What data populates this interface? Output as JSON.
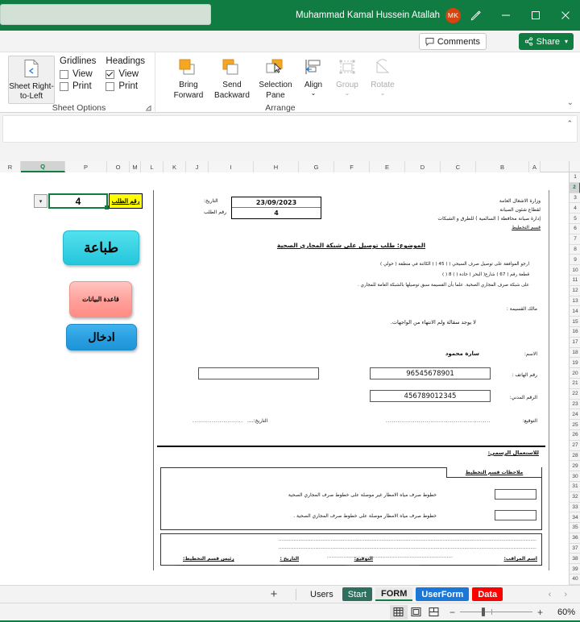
{
  "titlebar": {
    "search_placeholder": "",
    "account_name": "Muhammad Kamal Hussein Atallah",
    "avatar_initials": "MK",
    "pen_icon": "pen-icon",
    "minimize_label": "–",
    "restore_label": "❐",
    "close_label": "✕"
  },
  "command": {
    "comments_label": "Comments",
    "share_label": "Share",
    "share_caret": "▾"
  },
  "ribbon": {
    "sheet_options": {
      "group_label": "Sheet Options",
      "sheet_rtl_line1": "Sheet Right-",
      "sheet_rtl_line2": "to-Left",
      "gridlines_header": "Gridlines",
      "gridlines_view": "View",
      "gridlines_print": "Print",
      "gridlines_view_checked": false,
      "gridlines_print_checked": false,
      "headings_header": "Headings",
      "headings_view": "View",
      "headings_print": "Print",
      "headings_view_checked": true,
      "headings_print_checked": false,
      "dialog_launcher": "⌐"
    },
    "arrange": {
      "group_label": "Arrange",
      "bring_forward_l1": "Bring",
      "bring_forward_l2": "Forward",
      "send_backward_l1": "Send",
      "send_backward_l2": "Backward",
      "selection_pane_l1": "Selection",
      "selection_pane_l2": "Pane",
      "align_label": "Align",
      "group_btn_label": "Group",
      "rotate_label": "Rotate",
      "dropdown_caret": "⌄"
    },
    "collapse_caret": "⌄"
  },
  "formula_bar": {
    "value": "",
    "expand_caret": "⌃"
  },
  "grid": {
    "columns": [
      "R",
      "Q",
      "P",
      "O",
      "M",
      "L",
      "K",
      "J",
      "I",
      "H",
      "G",
      "F",
      "E",
      "D",
      "C",
      "B",
      "A"
    ],
    "selected_column": "Q",
    "rows": [
      1,
      2,
      3,
      4,
      5,
      6,
      7,
      8,
      9,
      10,
      11,
      12,
      13,
      14,
      15,
      16,
      17,
      18,
      19,
      20,
      21,
      22,
      23,
      24,
      25,
      26,
      27,
      28,
      29,
      30,
      31,
      32,
      33,
      34,
      35,
      36,
      37,
      38,
      39,
      40
    ],
    "selected_row": 2
  },
  "namebox": {
    "cell_value": "4",
    "dropdown_caret": "▾",
    "order_label": "رقم الطلب"
  },
  "macro_buttons": [
    {
      "name": "print-button",
      "label": "طباعة",
      "color": "#24c6dc"
    },
    {
      "name": "database-button",
      "label": "قاعدة البيانات",
      "color": "#ff8d86"
    },
    {
      "name": "entry-button",
      "label": "ادخال",
      "color": "#1e93d6"
    }
  ],
  "form": {
    "ministry": [
      "وزارة الاشغال العامة",
      "لقطاع شئون الصيانة",
      "إدارة صيانة محافظة (    السالمية    ) للطرق و الشبكات",
      "قسم التخطيط"
    ],
    "date_label": "التاريخ:",
    "date_value": "23/09/2023",
    "order_no_label": "رقم الطلب",
    "order_no_value": "4",
    "subject": "الموضوع: طلب توصيل على شبكة المجاري الصحية",
    "request_line1": "ارجو الموافقة على توصيل صرف السيحي (            )        45        (          )   الكائنة في منطقة (      حولي        )",
    "request_line2": "قطعة رقم (     67      )  شارع(         البحر         )                جادة           (          )       8       (          )",
    "request_line3": "على شبكة صرف المجاري الصحية.          علما بأن القسيمة      سبق         توصيلها بالشبكة العامة للمجاري .",
    "owner_label": "مالك القسيمة :",
    "owner_note": "لا يوجد سقالة ولم الانتهاء من الواجهات.",
    "name_label": "الاسم:",
    "name_value": "سارة محمود",
    "phone_label": "رقم الهاتف :",
    "phone_value": "96545678901",
    "civilid_label": "الرقم المدني:",
    "civilid_value": "456789012345",
    "signature_label": "التوقيع:",
    "date2_label": "التاريخ:....",
    "dots": "......................................................",
    "dots_short": "..........................",
    "official_use": "للاستعمال الرسمي:",
    "planning_notes_tab": "ملاحظات قسم التخطيط",
    "note_row1": "خطوط صرف مياه الامطار غير موصلة على خطوط صرف المجاري الصحية",
    "note_row2": "خطوط صرف مياه الامطار موصلة على خطوط صرف المجاري الصحية .",
    "dots_long": "........................................................................................................................................................................",
    "dots_mid": "..................................................................................",
    "sig_inspector": "اسم المراقب:",
    "sig_signature": "التوقيع:",
    "sig_date": "التاريخ :",
    "sig_head": "رئيس قسم التخطيط:"
  },
  "sheet_tabs": {
    "add_label": "+",
    "tabs": [
      {
        "label": "Users",
        "style": "plain",
        "active": false
      },
      {
        "label": "Start",
        "style": "green",
        "active": false
      },
      {
        "label": "FORM",
        "style": "active",
        "active": true
      },
      {
        "label": "UserForm",
        "style": "blue",
        "active": false
      },
      {
        "label": "Data",
        "style": "red",
        "active": false
      }
    ],
    "prev_arrow": "‹",
    "next_arrow": "›"
  },
  "statusbar": {
    "normal_view": "normal-view-icon",
    "page_layout_view": "page-layout-view-icon",
    "page_break_view": "page-break-view-icon",
    "zoom_out": "−",
    "zoom_in": "+",
    "zoom_level": "60%"
  }
}
